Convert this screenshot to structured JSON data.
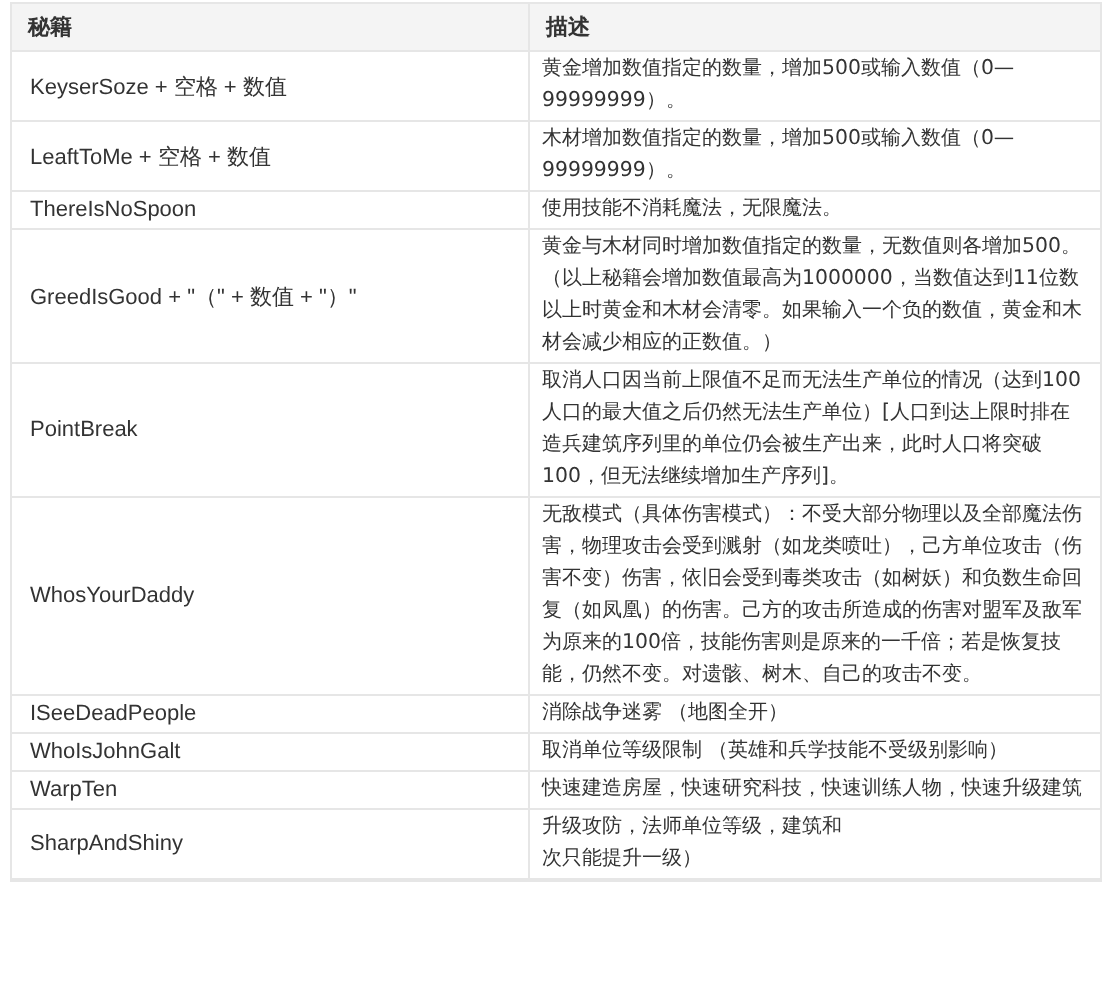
{
  "table": {
    "columns": [
      "秘籍",
      "描述"
    ],
    "rows": [
      {
        "code": "KeyserSoze + 空格 + 数值",
        "description": [
          "黄金增加数值指定的数量，增加500或输入数值（0—99999999）。"
        ]
      },
      {
        "code": "LeaftToMe + 空格 + 数值",
        "description": [
          "木材增加数值指定的数量，增加500或输入数值（0—99999999）。"
        ]
      },
      {
        "code": "ThereIsNoSpoon",
        "description": [
          "使用技能不消耗魔法，无限魔法。"
        ]
      },
      {
        "code": "GreedIsGood + \"（\" + 数值 + \"）\"",
        "description": [
          "黄金与木材同时增加数值指定的数量，无数值则各增加500。",
          "（以上秘籍会增加数值最高为1000000，当数值达到11位数以上时黄金和木材会清零。如果输入一个负的数值，黄金和木材会减少相应的正数值。）"
        ]
      },
      {
        "code": "PointBreak",
        "description": [
          "取消人口因当前上限值不足而无法生产单位的情况（达到100人口的最大值之后仍然无法生产单位）[人口到达上限时排在造兵建筑序列里的单位仍会被生产出来，此时人口将突破100，但无法继续增加生产序列]。"
        ]
      },
      {
        "code": "WhosYourDaddy",
        "description": [
          "无敌模式（具体伤害模式）：不受大部分物理以及全部魔法伤害，物理攻击会受到溅射（如龙类喷吐），己方单位攻击（伤害不变）伤害，依旧会受到毒类攻击（如树妖）和负数生命回复（如凤凰）的伤害。己方的攻击所造成的伤害对盟军及敌军为原来的100倍，技能伤害则是原来的一千倍；若是恢复技能，仍然不变。对遗骸、树木、自己的攻击不变。"
        ]
      },
      {
        "code": "ISeeDeadPeople",
        "description": [
          "消除战争迷雾 （地图全开）"
        ]
      },
      {
        "code": "WhoIsJohnGalt",
        "description": [
          "取消单位等级限制 （英雄和兵学技能不受级别影响）"
        ]
      },
      {
        "code": "WarpTen",
        "description": [
          "快速建造房屋，快速研究科技，快速训练人物，快速升级建筑"
        ]
      },
      {
        "code": "SharpAndShiny",
        "description": [
          "升级攻防，法师单位等级，建筑和",
          "次只能提升一级）"
        ]
      }
    ]
  }
}
